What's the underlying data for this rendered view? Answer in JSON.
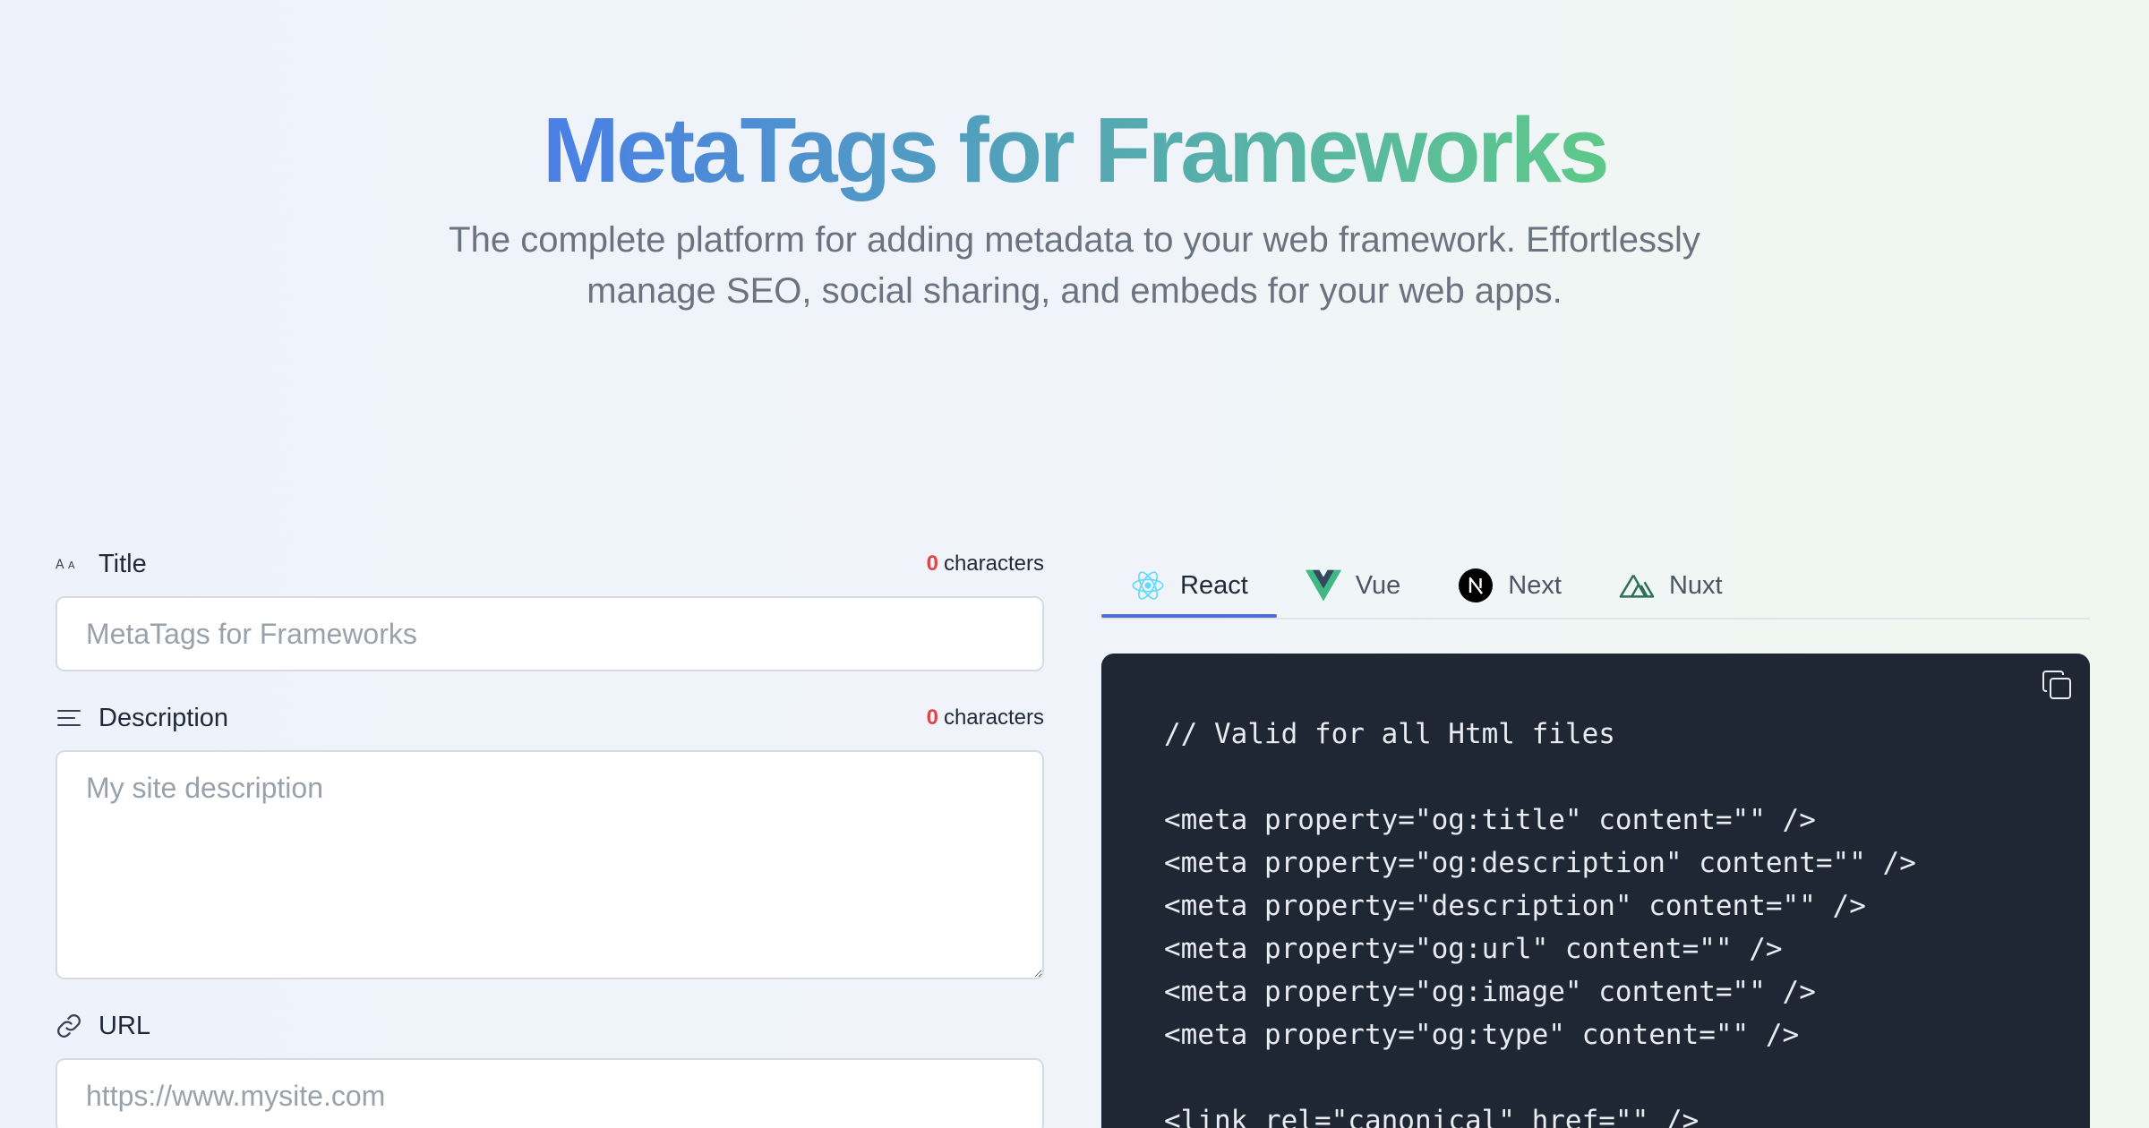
{
  "hero": {
    "title": "MetaTags for Frameworks",
    "subtitle": "The complete platform for adding metadata to your web framework. Effortlessly manage SEO, social sharing, and embeds for your web apps."
  },
  "form": {
    "title": {
      "label": "Title",
      "char_count": "0",
      "char_suffix": "characters",
      "placeholder": "MetaTags for Frameworks",
      "value": ""
    },
    "description": {
      "label": "Description",
      "char_count": "0",
      "char_suffix": "characters",
      "placeholder": "My site description",
      "value": ""
    },
    "url": {
      "label": "URL",
      "placeholder": "https://www.mysite.com",
      "value": ""
    }
  },
  "tabs": [
    {
      "label": "React",
      "icon": "react-icon",
      "active": true
    },
    {
      "label": "Vue",
      "icon": "vue-icon",
      "active": false
    },
    {
      "label": "Next",
      "icon": "next-icon",
      "active": false
    },
    {
      "label": "Nuxt",
      "icon": "nuxt-icon",
      "active": false
    }
  ],
  "code": {
    "lines": [
      "// Valid for all Html files",
      "",
      "<meta property=\"og:title\" content=\"\" />",
      "<meta property=\"og:description\" content=\"\" />",
      "<meta property=\"description\" content=\"\" />",
      "<meta property=\"og:url\" content=\"\" />",
      "<meta property=\"og:image\" content=\"\" />",
      "<meta property=\"og:type\" content=\"\" />",
      "",
      "<link rel=\"canonical\" href=\"\" />"
    ]
  },
  "colors": {
    "accent_tab": "#4f6ed1",
    "char_count": "#e0454a",
    "code_bg": "#1f2735",
    "title_gradient": [
      "#4a7fe6",
      "#54a7b4",
      "#5ec98a"
    ]
  }
}
